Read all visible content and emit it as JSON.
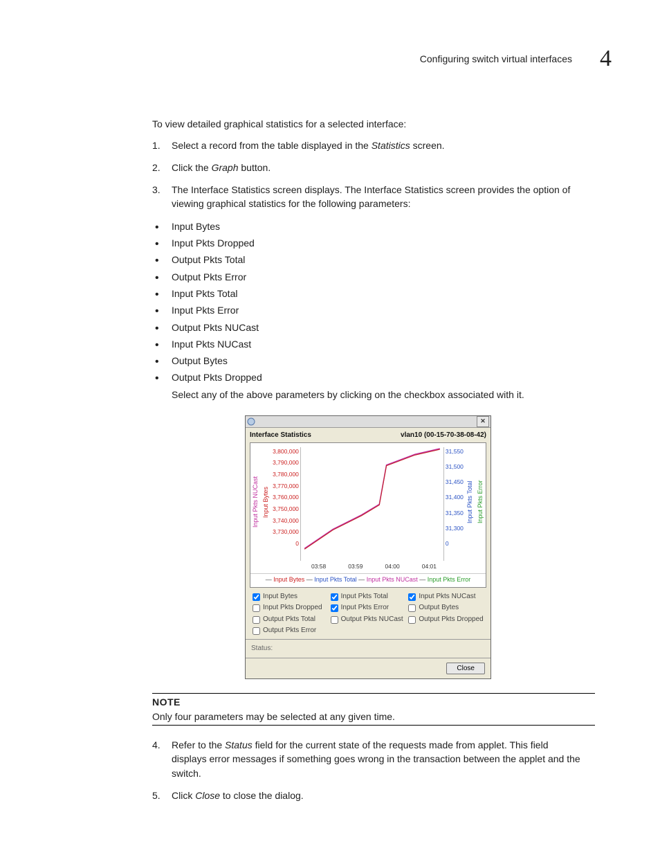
{
  "header": {
    "breadcrumb": "Configuring switch virtual interfaces",
    "chapter": "4"
  },
  "intro": "To view detailed graphical statistics for a selected interface:",
  "steps_a": [
    {
      "pre": "Select a record from the table displayed in the ",
      "em": "Statistics",
      "post": " screen."
    },
    {
      "pre": "Click the ",
      "em": "Graph",
      "post": " button."
    },
    {
      "pre": "The Interface Statistics screen displays. The Interface Statistics screen provides the option of viewing graphical statistics for the following parameters:",
      "em": "",
      "post": ""
    }
  ],
  "bullets": [
    "Input Bytes",
    "Input Pkts Dropped",
    "Output Pkts Total",
    "Output Pkts Error",
    "Input Pkts Total",
    "Input Pkts Error",
    "Output Pkts NUCast",
    "Input Pkts NUCast",
    "Output Bytes",
    "Output Pkts Dropped"
  ],
  "after_bullets": "Select any of the above parameters by clicking on the checkbox associated with it.",
  "note": {
    "head": "NOTE",
    "body": "Only four parameters may be selected at any given time."
  },
  "steps_b": [
    {
      "pre": "Refer to the ",
      "em": "Status",
      "post": " field for the current state of the requests made from applet. This field displays error messages if something goes wrong in the transaction between the applet and the switch."
    },
    {
      "pre": "Click ",
      "em": "Close",
      "post": " to close the dialog."
    }
  ],
  "win": {
    "title_left": "Interface Statistics",
    "title_right": "vlan10 (00-15-70-38-08-42)",
    "y_left_ticks": [
      "3,800,000",
      "3,790,000",
      "3,780,000",
      "3,770,000",
      "3,760,000",
      "3,750,000",
      "3,740,000",
      "3,730,000",
      "0"
    ],
    "y_right_ticks": [
      "31,550",
      "31,500",
      "31,450",
      "31,400",
      "31,350",
      "31,300",
      "0"
    ],
    "x_ticks": [
      "03:58",
      "03:59",
      "04:00",
      "04:01"
    ],
    "y_left_labels": {
      "nucast": "Input Pkts NUCast",
      "bytes": "Input Bytes"
    },
    "y_right_labels": {
      "total": "Input Pkts Total",
      "error": "Input Pkts Error"
    },
    "legend": {
      "bytes": "Input Bytes",
      "total": "Input Pkts Total",
      "nucast": "Input Pkts NUCast",
      "error": "Input Pkts Error"
    },
    "checks": [
      {
        "label": "Input Bytes",
        "checked": true
      },
      {
        "label": "Input Pkts Total",
        "checked": true
      },
      {
        "label": "Input Pkts NUCast",
        "checked": true
      },
      {
        "label": "Input Pkts Dropped",
        "checked": false
      },
      {
        "label": "Input Pkts Error",
        "checked": true
      },
      {
        "label": "Output Bytes",
        "checked": false
      },
      {
        "label": "Output Pkts Total",
        "checked": false
      },
      {
        "label": "Output Pkts NUCast",
        "checked": false
      },
      {
        "label": "Output Pkts Dropped",
        "checked": false
      },
      {
        "label": "Output Pkts Error",
        "checked": false
      }
    ],
    "status_label": "Status:",
    "close_label": "Close"
  },
  "chart_data": {
    "type": "line",
    "title": "Interface Statistics",
    "x": [
      "03:58",
      "03:59",
      "04:00",
      "04:01"
    ],
    "xlabel": "",
    "left_axis": {
      "label": "Input Bytes",
      "range": [
        3730000,
        3800000
      ]
    },
    "right_axis": {
      "label": "Input Pkts Total",
      "range": [
        31300,
        31550
      ]
    },
    "series": [
      {
        "name": "Input Bytes",
        "axis": "left",
        "color": "#c22222",
        "values": [
          3733000,
          3752000,
          3768000,
          3800000
        ]
      },
      {
        "name": "Input Pkts Total",
        "axis": "right",
        "color": "#2a52c4",
        "values": [
          31310,
          31400,
          31460,
          31560
        ]
      },
      {
        "name": "Input Pkts NUCast",
        "axis": "right",
        "color": "#c030a0",
        "values": [
          31310,
          31400,
          31460,
          31560
        ]
      },
      {
        "name": "Input Pkts Error",
        "axis": "right",
        "color": "#2a9c2a",
        "values": [
          0,
          0,
          0,
          0
        ]
      }
    ]
  }
}
